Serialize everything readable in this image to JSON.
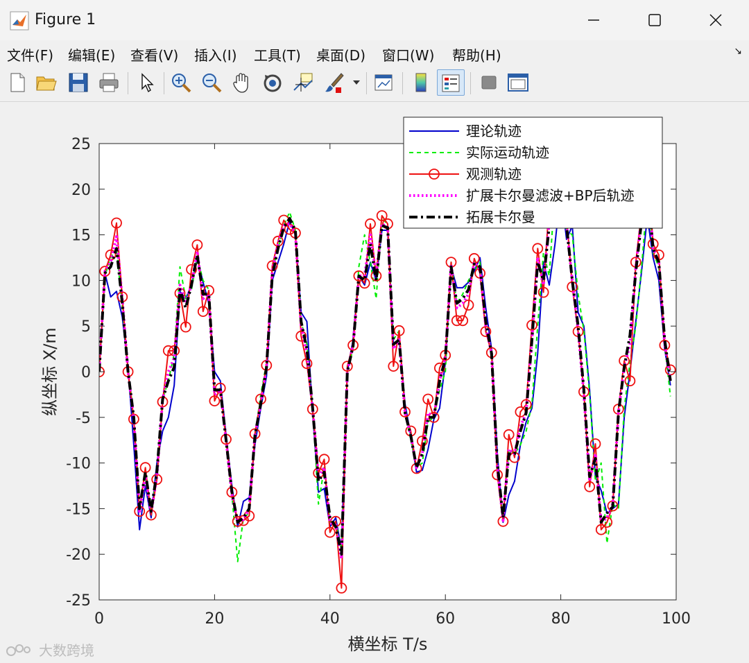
{
  "window": {
    "title": "Figure 1",
    "minimize_icon": "minimize-icon",
    "maximize_icon": "maximize-icon",
    "close_icon": "close-icon"
  },
  "menu": [
    "文件(F)",
    "编辑(E)",
    "查看(V)",
    "插入(I)",
    "工具(T)",
    "桌面(D)",
    "窗口(W)",
    "帮助(H)"
  ],
  "menu_corner": "↘",
  "toolbar": {
    "icons": [
      "new-figure-icon",
      "open-file-icon",
      "save-icon",
      "print-icon",
      "pointer-icon",
      "zoom-in-icon",
      "zoom-out-icon",
      "pan-hand-icon",
      "rotate-3d-icon",
      "data-cursor-icon",
      "brush-icon",
      "dropdown-arrow-icon",
      "link-plot-icon",
      "colorbar-icon",
      "legend-icon",
      "hide-tools-icon",
      "dock-icon"
    ]
  },
  "watermark": "大数跨境",
  "chart_data": {
    "type": "line",
    "xlabel": "横坐标 T/s",
    "ylabel": "纵坐标 X/m",
    "xlim": [
      0,
      100
    ],
    "ylim": [
      -25,
      25
    ],
    "xticks": [
      0,
      20,
      40,
      60,
      80,
      100
    ],
    "yticks": [
      -25,
      -20,
      -15,
      -10,
      -5,
      0,
      5,
      10,
      15,
      20,
      25
    ],
    "grid": false,
    "legend_position": "top-right",
    "colors": {
      "theory": "#0000cc",
      "actual": "#00ee00",
      "observed": "#ee1111",
      "ekf_bp": "#ff00ff",
      "ekf": "#000000"
    },
    "x": [
      0,
      1,
      2,
      3,
      4,
      5,
      6,
      7,
      8,
      9,
      10,
      11,
      12,
      13,
      14,
      15,
      16,
      17,
      18,
      19,
      20,
      21,
      22,
      23,
      24,
      25,
      26,
      27,
      28,
      29,
      30,
      31,
      32,
      33,
      34,
      35,
      36,
      37,
      38,
      39,
      40,
      41,
      42,
      43,
      44,
      45,
      46,
      47,
      48,
      49,
      50,
      51,
      52,
      53,
      54,
      55,
      56,
      57,
      58,
      59,
      60,
      61,
      62,
      63,
      64,
      65,
      66,
      67,
      68,
      69,
      70,
      71,
      72,
      73,
      74,
      75,
      76,
      77,
      78,
      79,
      80,
      81,
      82,
      83,
      84,
      85,
      86,
      87,
      88,
      89,
      90,
      91,
      92,
      93,
      94,
      95,
      96,
      97,
      98,
      99
    ],
    "series": [
      {
        "name": "理论轨迹",
        "style": "solid",
        "marker": "none",
        "values": [
          0,
          10.8,
          8.2,
          8.8,
          6.0,
          0.5,
          -8.0,
          -17.3,
          -12.5,
          -16.0,
          -10.0,
          -6.5,
          -5.0,
          -1.5,
          8.8,
          8.0,
          9.5,
          12.5,
          9.8,
          7.5,
          0,
          -1.0,
          -7.0,
          -12.5,
          -17.0,
          -14.2,
          -13.8,
          -8.0,
          -4.0,
          -0.5,
          10.0,
          12.0,
          14.0,
          16.5,
          15.0,
          6.5,
          5.5,
          -4.5,
          -13.2,
          -12.8,
          -17.0,
          -16.0,
          -19.5,
          0,
          3.5,
          10.5,
          9.5,
          12.0,
          10.0,
          15.5,
          15.5,
          3.0,
          3.5,
          -3.5,
          -7.0,
          -11.0,
          -10.8,
          -8.5,
          -5.2,
          -4.0,
          1.0,
          11.5,
          9.2,
          9.2,
          9.8,
          11.0,
          12.5,
          7.0,
          2.5,
          -9.0,
          -16.5,
          -13.5,
          -12.0,
          -8.0,
          -5.5,
          -4.0,
          2.0,
          12.0,
          9.5,
          14.0,
          20.0,
          14.5,
          16.0,
          6.5,
          5.0,
          -2.0,
          -11.5,
          -13.0,
          -15.5,
          -15.0,
          -14.5,
          -5.0,
          0,
          5.5,
          11.0,
          17.0,
          12.5,
          10.0,
          2.5,
          -1.5
        ]
      },
      {
        "name": "实际运动轨迹",
        "style": "dashed",
        "marker": "none",
        "values": [
          0,
          10.5,
          12.5,
          13.5,
          7.0,
          0.5,
          -5.0,
          -14.5,
          -11.0,
          -15.0,
          -11.5,
          -3.0,
          -1.0,
          2.0,
          11.5,
          8.0,
          9.0,
          12.5,
          10.0,
          9.0,
          -2.5,
          -2.0,
          -7.5,
          -13.5,
          -20.8,
          -16.0,
          -15.5,
          -7.0,
          -2.5,
          1.0,
          11.0,
          13.5,
          16.0,
          17.5,
          15.5,
          5.5,
          3.0,
          -4.0,
          -14.5,
          -10.5,
          -16.5,
          -16.5,
          -19.5,
          0,
          2.5,
          11.5,
          15.0,
          12.0,
          8.0,
          17.0,
          16.0,
          3.5,
          4.5,
          -4.0,
          -7.5,
          -10.5,
          -10.0,
          -5.5,
          -5.0,
          -2.0,
          0,
          12.0,
          7.5,
          8.5,
          10.0,
          11.0,
          12.0,
          4.5,
          2.0,
          -11.0,
          -16.0,
          -8.5,
          -9.0,
          -8.0,
          -6.5,
          -3.5,
          5.0,
          13.0,
          10.5,
          20.0,
          22.0,
          15.5,
          15.0,
          8.5,
          4.5,
          -2.5,
          -12.0,
          -10.0,
          -18.8,
          -14.5,
          -15.0,
          -4.0,
          1.0,
          5.0,
          11.5,
          19.0,
          13.0,
          11.5,
          3.0,
          -2.7
        ]
      },
      {
        "name": "观测轨迹",
        "style": "solid",
        "marker": "circle",
        "values": [
          0,
          11.0,
          12.8,
          16.3,
          8.2,
          0,
          -5.2,
          -15.3,
          -10.5,
          -15.7,
          -11.8,
          -3.3,
          2.3,
          2.3,
          8.6,
          4.9,
          11.2,
          13.9,
          6.6,
          8.9,
          -3.2,
          -1.8,
          -7.4,
          -13.2,
          -16.4,
          -16.3,
          -15.8,
          -6.8,
          -3.0,
          0.7,
          11.6,
          14.3,
          16.6,
          15.6,
          15.2,
          3.9,
          0.9,
          -4.1,
          -11.1,
          -9.6,
          -17.6,
          -16.4,
          -23.7,
          0.6,
          2.9,
          10.5,
          9.7,
          16.2,
          10.5,
          17.1,
          16.2,
          0.6,
          4.5,
          -4.4,
          -6.5,
          -10.6,
          -7.6,
          -3.0,
          -5.0,
          0.4,
          1.8,
          12.0,
          5.6,
          5.6,
          7.3,
          12.4,
          10.8,
          4.4,
          2.1,
          -11.3,
          -16.4,
          -6.9,
          -9.4,
          -4.4,
          -3.6,
          5.1,
          13.5,
          8.7,
          18.6,
          20.0,
          22.0,
          17.0,
          9.3,
          4.4,
          -2.2,
          -12.6,
          -7.9,
          -17.3,
          -16.5,
          -14.7,
          -4.1,
          1.2,
          -1.0,
          12.0,
          17.5,
          23.0,
          14.0,
          12.8,
          2.9,
          0.2
        ]
      },
      {
        "name": "扩展卡尔曼滤波+BP后轨迹",
        "style": "dotted",
        "marker": "none",
        "values": [
          0,
          11.0,
          12.0,
          14.8,
          8.0,
          0,
          -5.2,
          -15.3,
          -11.5,
          -15.5,
          -11.5,
          -3.0,
          0,
          1.5,
          9.5,
          7.5,
          9.5,
          13.2,
          8.0,
          8.5,
          -2.5,
          -2.0,
          -7.5,
          -13.5,
          -16.5,
          -16.2,
          -15.0,
          -7.0,
          -3.5,
          0.5,
          11.0,
          14.0,
          16.0,
          16.2,
          15.2,
          5.0,
          2.0,
          -4.0,
          -11.5,
          -10.5,
          -16.5,
          -16.8,
          -20.5,
          0,
          3.0,
          10.5,
          10.5,
          15.0,
          10.5,
          16.2,
          15.8,
          2.5,
          3.5,
          -4.5,
          -7.0,
          -10.5,
          -9.0,
          -4.5,
          -5.0,
          -1.0,
          1.5,
          11.8,
          7.0,
          7.5,
          8.5,
          12.0,
          11.2,
          5.0,
          2.0,
          -10.5,
          -16.3,
          -8.5,
          -9.0,
          -6.0,
          -4.5,
          3.5,
          12.5,
          9.5,
          16.5,
          20.0,
          20.0,
          16.0,
          10.0,
          4.5,
          -2.5,
          -12.0,
          -9.0,
          -16.5,
          -16.0,
          -14.5,
          -4.5,
          0.5,
          3.0,
          11.5,
          17.0,
          21.0,
          13.5,
          12.0,
          3.0,
          -1.0
        ]
      },
      {
        "name": "拓展卡尔曼",
        "style": "dashdot",
        "marker": "none",
        "values": [
          0,
          10.8,
          11.5,
          13.5,
          7.5,
          0,
          -5.0,
          -15.0,
          -11.0,
          -15.3,
          -11.0,
          -3.0,
          -1.0,
          0.5,
          9.0,
          7.0,
          9.5,
          12.8,
          8.5,
          8.5,
          -2.0,
          -2.0,
          -7.5,
          -13.2,
          -16.5,
          -16.0,
          -15.0,
          -7.0,
          -3.5,
          0.5,
          10.5,
          13.5,
          15.8,
          16.8,
          15.5,
          5.5,
          2.5,
          -4.0,
          -12.0,
          -11.0,
          -16.0,
          -17.0,
          -20.0,
          0,
          2.8,
          10.5,
          10.0,
          14.0,
          10.0,
          16.0,
          15.8,
          3.0,
          3.5,
          -4.5,
          -7.0,
          -10.5,
          -9.0,
          -5.0,
          -5.0,
          -1.0,
          1.5,
          11.5,
          7.5,
          8.0,
          9.0,
          11.8,
          11.5,
          5.5,
          2.0,
          -10.0,
          -16.0,
          -9.0,
          -9.0,
          -6.5,
          -4.5,
          3.5,
          12.0,
          10.0,
          16.0,
          20.0,
          20.0,
          16.0,
          10.0,
          5.0,
          -2.0,
          -11.5,
          -9.5,
          -16.5,
          -15.5,
          -14.8,
          -4.5,
          0.5,
          4.0,
          11.0,
          16.5,
          20.5,
          13.5,
          12.0,
          3.5,
          -1.0
        ]
      }
    ]
  }
}
